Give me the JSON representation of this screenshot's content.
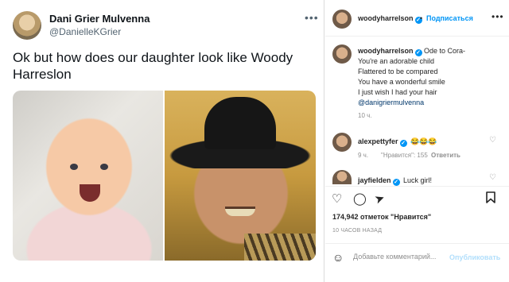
{
  "tweet": {
    "name": "Dani Grier Mulvenna",
    "handle": "@DanielleKGrier",
    "more_icon": "ellipsis-icon",
    "text": "Ok but how does our daughter look like Woody Harreslon"
  },
  "post": {
    "username": "woodyharrelson",
    "follow_label": "Подписаться",
    "separator": "•",
    "caption_user": "woodyharrelson",
    "caption_lines": [
      "Ode to Cora-",
      "You're an adorable child",
      "Flattered to be compared",
      "You have a wonderful smile",
      "I just wish I had your hair"
    ],
    "caption_tag": "@danigriermulvenna",
    "caption_time": "10 ч.",
    "comments": [
      {
        "user": "alexpettyfer",
        "text": "😂😂😂",
        "time": "9 ч.",
        "likes": "\"Нравится\": 155",
        "reply": "Ответить"
      },
      {
        "user": "jayfielden",
        "text": "Luck girl!"
      }
    ],
    "likes_text": "174,942 отметок \"Нравится\"",
    "post_time": "10 ЧАСОВ НАЗАД",
    "comment_placeholder": "Добавьте комментарий...",
    "publish_label": "Опубликовать"
  },
  "colors": {
    "accent": "#0095f6",
    "text": "#262626",
    "muted": "#8e8e8e"
  }
}
